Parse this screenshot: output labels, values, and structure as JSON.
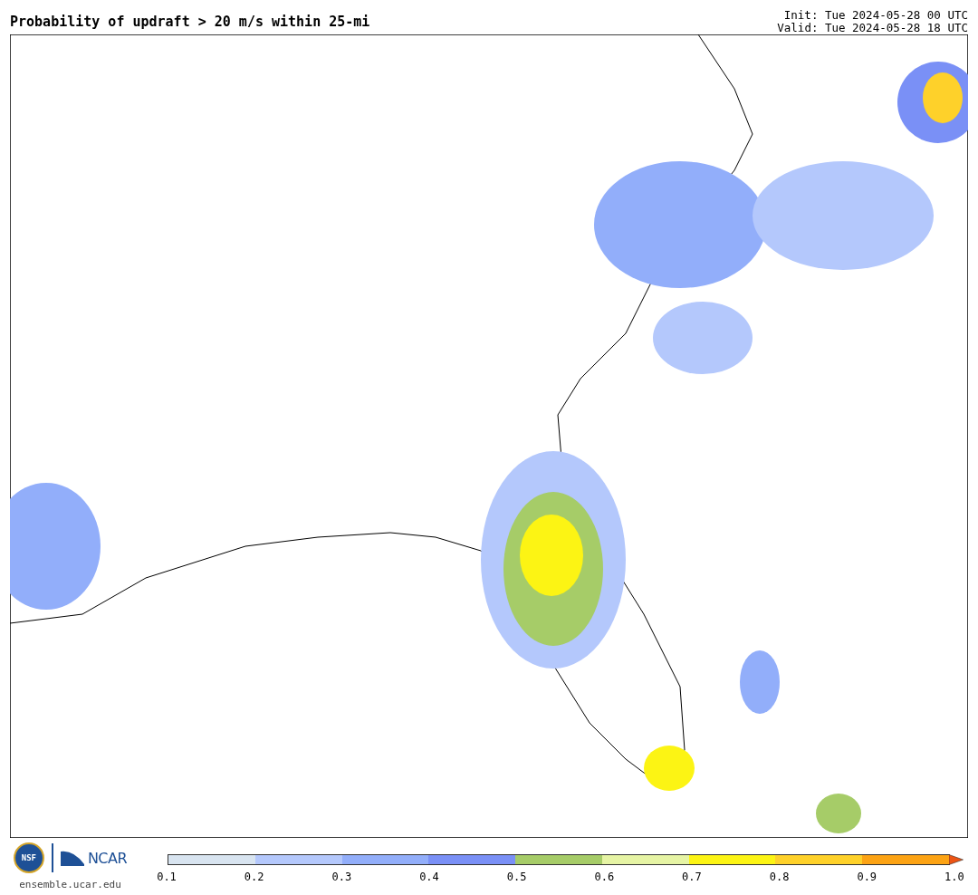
{
  "title": "Probability of updraft > 20 m/s within 25-mi",
  "init": "Init: Tue 2024-05-28 00 UTC",
  "valid": "Valid: Tue 2024-05-28 18 UTC",
  "logos": {
    "nsf": "NSF",
    "ncar": "NCAR"
  },
  "site": "ensemble.ucar.edu",
  "colorbar": {
    "segments": [
      {
        "color": "#d8e4f0"
      },
      {
        "color": "#b4c8fc"
      },
      {
        "color": "#92aefa"
      },
      {
        "color": "#7a90f6"
      },
      {
        "color": "#a6cc68"
      },
      {
        "color": "#e6f4a4"
      },
      {
        "color": "#fcf414"
      },
      {
        "color": "#fed12a"
      },
      {
        "color": "#fca314"
      }
    ],
    "extension": {
      "color": "#ec5414"
    },
    "ticks": [
      "0.1",
      "0.2",
      "0.3",
      "0.4",
      "0.5",
      "0.6",
      "0.7",
      "0.8",
      "0.9",
      "1.0"
    ]
  }
}
